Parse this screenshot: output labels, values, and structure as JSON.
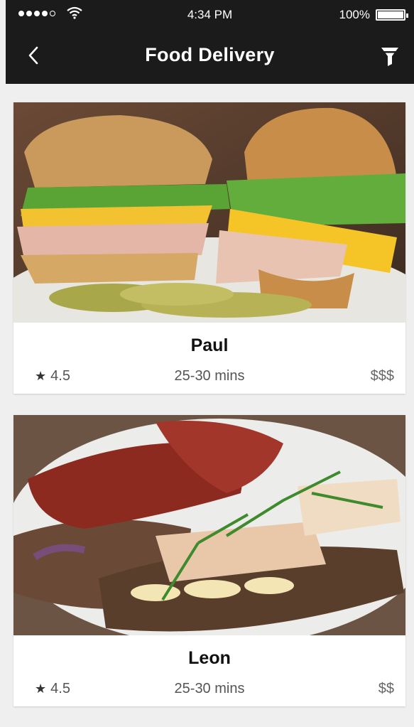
{
  "status_bar": {
    "time": "4:34 PM",
    "battery": "100%"
  },
  "nav": {
    "title": "Food Delivery",
    "back_icon": "chevron-left-icon",
    "filter_icon": "filter-icon"
  },
  "restaurants": [
    {
      "name": "Paul",
      "rating": "4.5",
      "eta": "25-30 mins",
      "price": "$$$"
    },
    {
      "name": "Leon",
      "rating": "4.5",
      "eta": "25-30 mins",
      "price": "$$"
    }
  ],
  "colors": {
    "bar": "#1b1b1b",
    "background": "#efefef",
    "card": "#ffffff"
  }
}
